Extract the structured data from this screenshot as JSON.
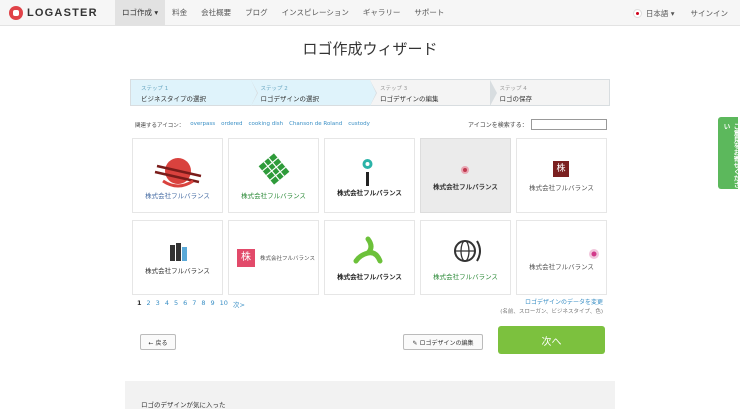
{
  "brand": {
    "name": "LOGASTER"
  },
  "nav": {
    "items": [
      {
        "label": "ロゴ作成 ▾"
      },
      {
        "label": "料金"
      },
      {
        "label": "会社概要"
      },
      {
        "label": "ブログ"
      },
      {
        "label": "インスピレーション"
      },
      {
        "label": "ギャラリー"
      },
      {
        "label": "サポート"
      }
    ],
    "language": "日本語 ▾",
    "signin": "サインイン"
  },
  "page": {
    "title": "ロゴ作成ウィザード"
  },
  "steps": [
    {
      "num": "ステップ 1",
      "label": "ビジネスタイプの選択"
    },
    {
      "num": "ステップ 2",
      "label": "ロゴデザインの選択"
    },
    {
      "num": "ステップ 3",
      "label": "ロゴデザインの編集"
    },
    {
      "num": "ステップ 4",
      "label": "ロゴの保存"
    }
  ],
  "related": {
    "label": "関連するアイコン：",
    "tags": [
      "overpass",
      "ordered",
      "cooking dish",
      "Chanson de Roland",
      "custody"
    ]
  },
  "search": {
    "label": "アイコンを検索する：",
    "value": ""
  },
  "logos": [
    {
      "text": "株式会社フルバランス",
      "color": "#4a6fa5",
      "icon": "red-bowl-chopsticks-icon"
    },
    {
      "text": "株式会社フルバランス",
      "color": "#2e8b3a",
      "icon": "green-leaf-grid-icon"
    },
    {
      "text": "株式会社フルバランス",
      "color": "#222222",
      "icon": "teal-antenna-icon"
    },
    {
      "text": "株式会社フルバランス",
      "color": "#333333",
      "icon": "pink-dot-icon"
    },
    {
      "text": "株式会社フルバランス",
      "color": "#555555",
      "icon": "kanji-stamp-icon",
      "stamp": "株"
    },
    {
      "text": "株式会社フルバランス",
      "color": "#333333",
      "icon": "bookends-icon"
    },
    {
      "text": "株式会社フルバランス",
      "color": "#555555",
      "icon": "pink-kanji-stamp-icon",
      "stamp": "株"
    },
    {
      "text": "株式会社フルバランス",
      "color": "#222222",
      "icon": "green-triskelion-icon"
    },
    {
      "text": "株式会社フルバランス",
      "color": "#2e8b3a",
      "icon": "globe-icon"
    },
    {
      "text": "株式会社フルバランス",
      "color": "#555555",
      "icon": "pink-sun-icon"
    }
  ],
  "pagination": {
    "pages": [
      "1",
      "2",
      "3",
      "4",
      "5",
      "6",
      "7",
      "8",
      "9",
      "10",
      "次>"
    ]
  },
  "edit_data": {
    "link": "ロゴデザインのデータを変更",
    "hint": "(名前、スローガン、ビジネスタイプ、色)"
  },
  "buttons": {
    "back": "← 戻る",
    "edit": "✎ ロゴデザインの編集",
    "next": "次へ"
  },
  "bottom": {
    "text": "ロゴのデザインが気に入った"
  },
  "side_tab": {
    "text": "ご意見をお寄せください"
  },
  "colors": {
    "accent": "#7cc13e",
    "brand": "#e04248",
    "link": "#3a8fc5",
    "step_done": "#dff3fb"
  }
}
